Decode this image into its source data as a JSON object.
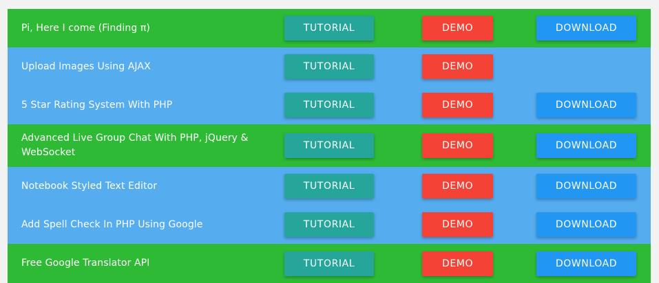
{
  "colors": {
    "row_green": "#2fba35",
    "row_blue": "#55acee",
    "tutorial_button": "#26a69a",
    "demo_button": "#f44336",
    "download_button": "#2196f3"
  },
  "rows": [
    {
      "title": "Pi, Here I come (Finding π)",
      "tutorial": "TUTORIAL",
      "demo": "DEMO",
      "download": "DOWNLOAD",
      "color": "green"
    },
    {
      "title": "Upload Images Using AJAX",
      "tutorial": "TUTORIAL",
      "demo": "DEMO",
      "download": "",
      "color": "blue"
    },
    {
      "title": "5 Star Rating System With PHP",
      "tutorial": "TUTORIAL",
      "demo": "DEMO",
      "download": "DOWNLOAD",
      "color": "blue"
    },
    {
      "title": "Advanced Live Group Chat With PHP, jQuery & WebSocket",
      "tutorial": "TUTORIAL",
      "demo": "DEMO",
      "download": "DOWNLOAD",
      "color": "green"
    },
    {
      "title": "Notebook Styled Text Editor",
      "tutorial": "TUTORIAL",
      "demo": "DEMO",
      "download": "DOWNLOAD",
      "color": "blue"
    },
    {
      "title": "Add Spell Check In PHP Using Google",
      "tutorial": "TUTORIAL",
      "demo": "DEMO",
      "download": "DOWNLOAD",
      "color": "blue"
    },
    {
      "title": "Free Google Translator API",
      "tutorial": "TUTORIAL",
      "demo": "DEMO",
      "download": "DOWNLOAD",
      "color": "green"
    }
  ]
}
